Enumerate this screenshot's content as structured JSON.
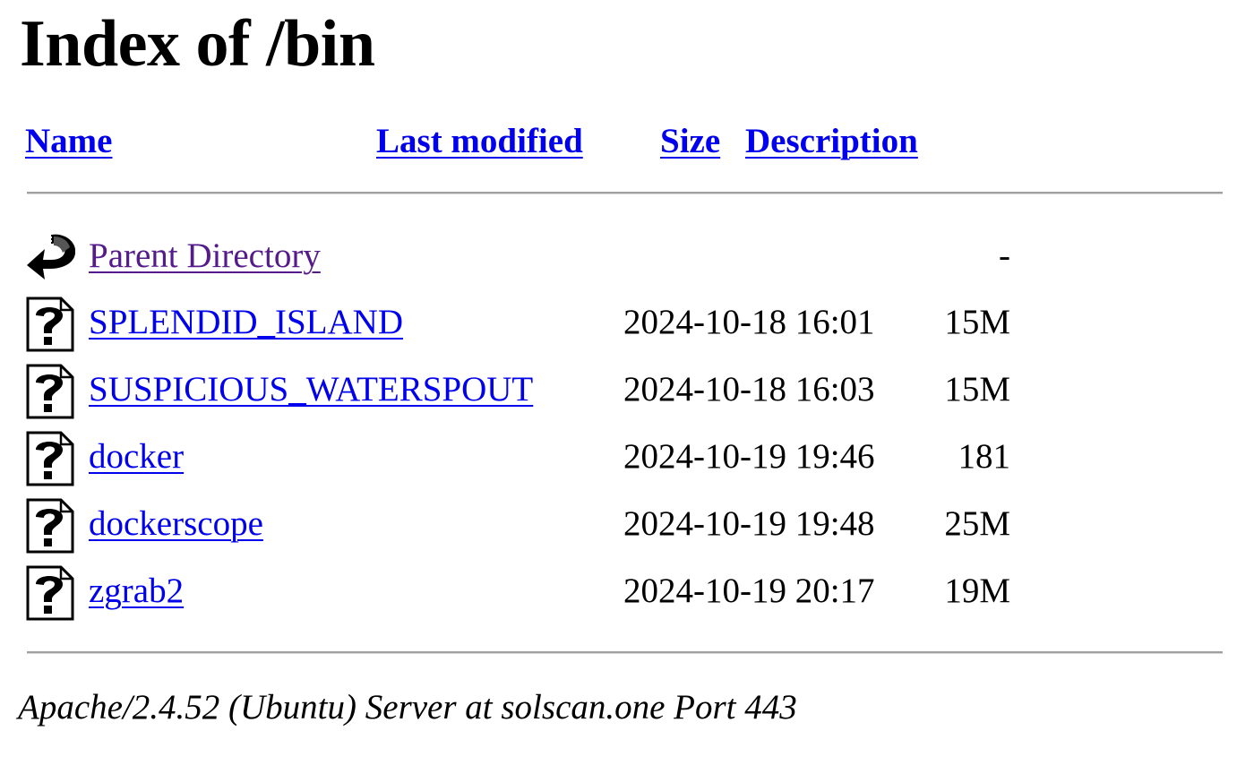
{
  "page": {
    "title": "Index of /bin"
  },
  "table": {
    "headers": {
      "name": "Name",
      "last_modified": "Last modified",
      "size": "Size",
      "description": "Description"
    },
    "parent": {
      "icon": "back-arrow-icon",
      "name": "Parent Directory",
      "last_modified": "",
      "size": "-"
    },
    "rows": [
      {
        "icon": "unknown-file-icon",
        "name": "SPLENDID_ISLAND",
        "last_modified": "2024-10-18 16:01",
        "size": "15M"
      },
      {
        "icon": "unknown-file-icon",
        "name": "SUSPICIOUS_WATERSPOUT",
        "last_modified": "2024-10-18 16:03",
        "size": "15M"
      },
      {
        "icon": "unknown-file-icon",
        "name": "docker",
        "last_modified": "2024-10-19 19:46",
        "size": "181"
      },
      {
        "icon": "unknown-file-icon",
        "name": "dockerscope",
        "last_modified": "2024-10-19 19:48",
        "size": "25M"
      },
      {
        "icon": "unknown-file-icon",
        "name": "zgrab2",
        "last_modified": "2024-10-19 20:17",
        "size": "19M"
      }
    ]
  },
  "footer": {
    "text": "Apache/2.4.52 (Ubuntu) Server at solscan.one Port 443"
  },
  "colors": {
    "link": "#0000ee",
    "visited_link": "#551a8b",
    "rule": "#a0a0a0"
  }
}
